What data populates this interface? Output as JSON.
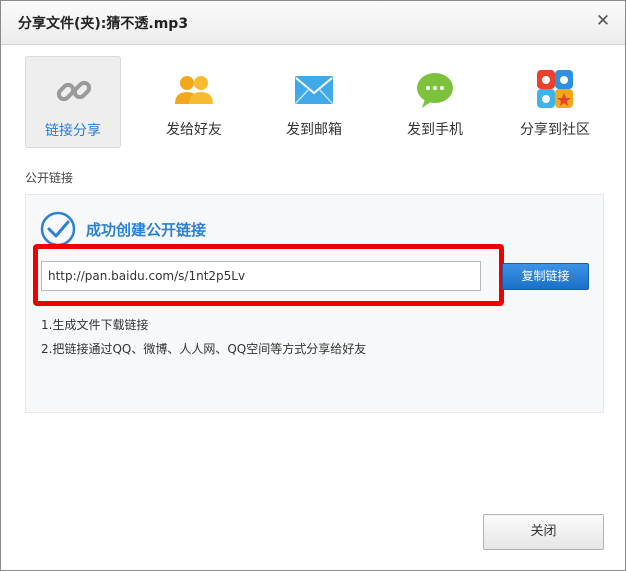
{
  "dialog": {
    "title": "分享文件(夹):猜不透.mp3",
    "close_symbol": "✕"
  },
  "tabs": [
    {
      "label": "链接分享",
      "icon": "link-icon",
      "active": true
    },
    {
      "label": "发给好友",
      "icon": "friends-icon",
      "active": false
    },
    {
      "label": "发到邮箱",
      "icon": "email-icon",
      "active": false
    },
    {
      "label": "发到手机",
      "icon": "sms-icon",
      "active": false
    },
    {
      "label": "分享到社区",
      "icon": "community-icon",
      "active": false
    }
  ],
  "section": {
    "label": "公开链接"
  },
  "panel": {
    "success_text": "成功创建公开链接",
    "link_value": "http://pan.baidu.com/s/1nt2p5Lv",
    "copy_button": "复制链接",
    "notes": [
      "1.生成文件下载链接",
      "2.把链接通过QQ、微博、人人网、QQ空间等方式分享给好友"
    ]
  },
  "footer": {
    "close_button": "关闭"
  },
  "colors": {
    "accent": "#2b80d4",
    "highlight": "#ee0000",
    "button": "#1a6fc8"
  }
}
